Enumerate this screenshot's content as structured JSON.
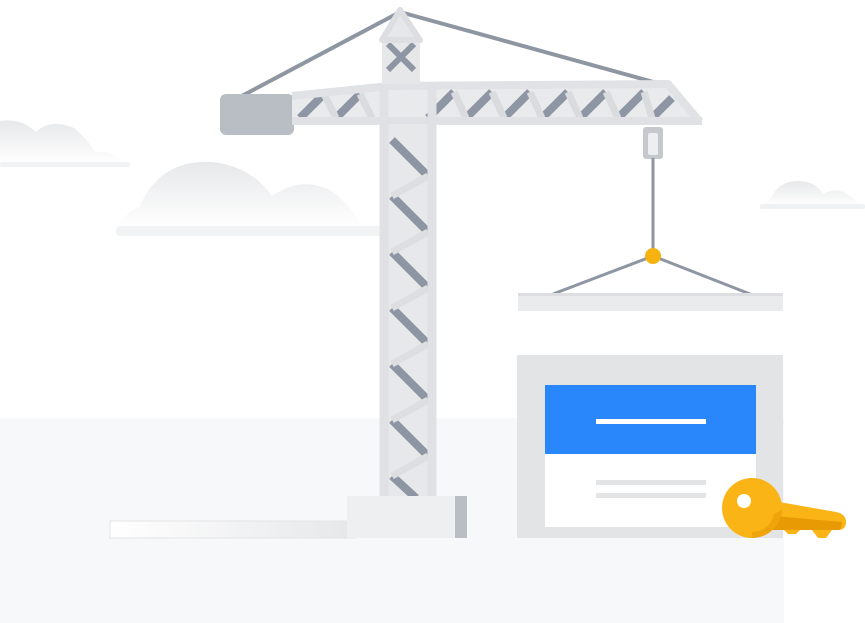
{
  "illustration": {
    "subject": "under-construction",
    "icons": [
      "crane-icon",
      "cloud-icon",
      "web-page-icon",
      "key-icon"
    ],
    "colors": {
      "background": "#ffffff",
      "ground": "#f7f8f9",
      "crane_light": "#e8e9eb",
      "crane_mid": "#d6d8db",
      "crane_dark": "#8d96a2",
      "counterweight": "#b9bec5",
      "hook": "#f6b30f",
      "page_header": "#2a86fb",
      "page_frame": "#e3e4e6",
      "key": "#fbb416",
      "key_shadow": "#e89a05"
    }
  }
}
